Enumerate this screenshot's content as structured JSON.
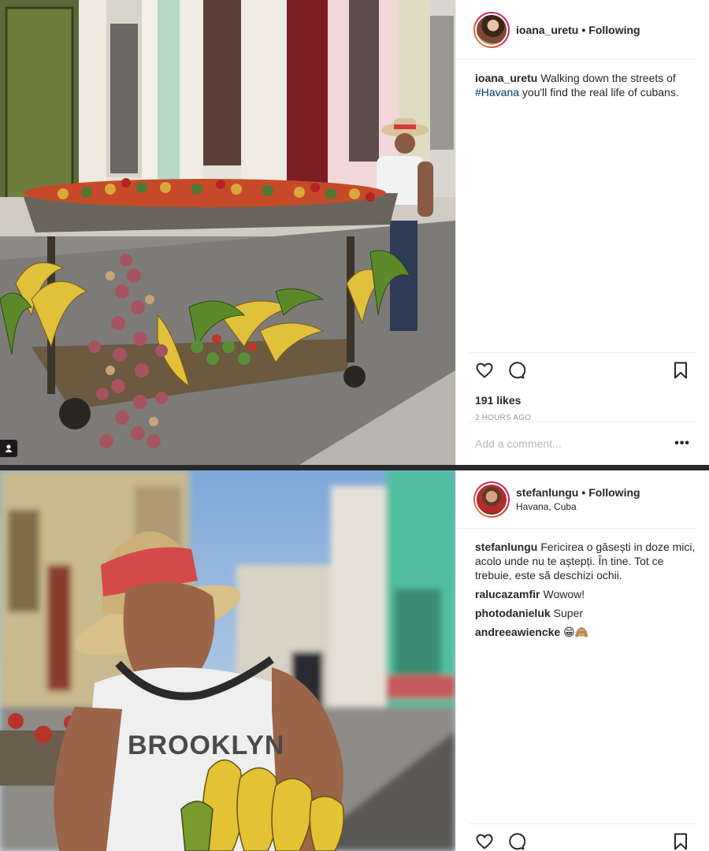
{
  "posts": [
    {
      "username": "ioana_uretu",
      "follow_sep": "•",
      "follow_status": "Following",
      "location": "",
      "caption_user": "ioana_uretu",
      "caption_text_before": "Walking down the streets of ",
      "caption_hashtag": "#Havana",
      "caption_text_after": " you'll find the real life of cubans.",
      "likes": "191 likes",
      "timestamp": "2 HOURS AGO",
      "comment_placeholder": "Add a comment...",
      "more_label": "•••"
    },
    {
      "username": "stefanlungu",
      "follow_sep": "•",
      "follow_status": "Following",
      "location": "Havana, Cuba",
      "caption_user": "stefanlungu",
      "caption_text": "Fericirea o găsești in doze mici, acolo unde nu te aștepți. În tine. Tot ce trebuie, este să deschizi ochii.",
      "comments": [
        {
          "user": "ralucazamfir",
          "text": "Wowow!"
        },
        {
          "user": "photodanieluk",
          "text": "Super"
        },
        {
          "user": "andreeawiencke",
          "text": "😁🙈"
        }
      ]
    }
  ],
  "photo_text": "BROOKLYN",
  "colors": {
    "hashtag": "#003569",
    "muted": "#999999",
    "border": "#efefef"
  }
}
